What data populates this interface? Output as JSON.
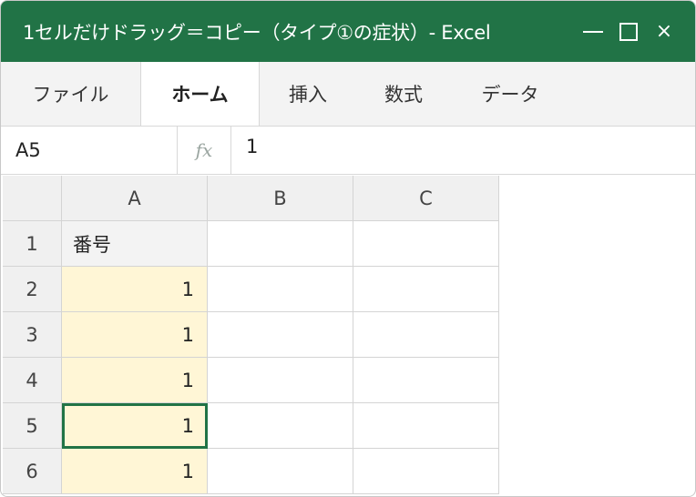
{
  "window": {
    "title": "1セルだけドラッグ＝コピー（タイプ①の症状）- Excel",
    "close_glyph": "×"
  },
  "ribbon": {
    "tabs": [
      {
        "label": "ファイル",
        "active": false
      },
      {
        "label": "ホーム",
        "active": true
      },
      {
        "label": "挿入",
        "active": false
      },
      {
        "label": "数式",
        "active": false
      },
      {
        "label": "データ",
        "active": false
      }
    ]
  },
  "formula_bar": {
    "name_box": "A5",
    "fx_label": "fx",
    "value": "1"
  },
  "sheet": {
    "columns": [
      "A",
      "B",
      "C"
    ],
    "rows": [
      {
        "number": "1",
        "cells": [
          "番号",
          "",
          ""
        ]
      },
      {
        "number": "2",
        "cells": [
          "1",
          "",
          ""
        ]
      },
      {
        "number": "3",
        "cells": [
          "1",
          "",
          ""
        ]
      },
      {
        "number": "4",
        "cells": [
          "1",
          "",
          ""
        ]
      },
      {
        "number": "5",
        "cells": [
          "1",
          "",
          ""
        ]
      },
      {
        "number": "6",
        "cells": [
          "1",
          "",
          ""
        ]
      }
    ],
    "selected_cell": "A5",
    "colors": {
      "accent": "#217346",
      "copied_fill": "#fff6d6"
    }
  }
}
